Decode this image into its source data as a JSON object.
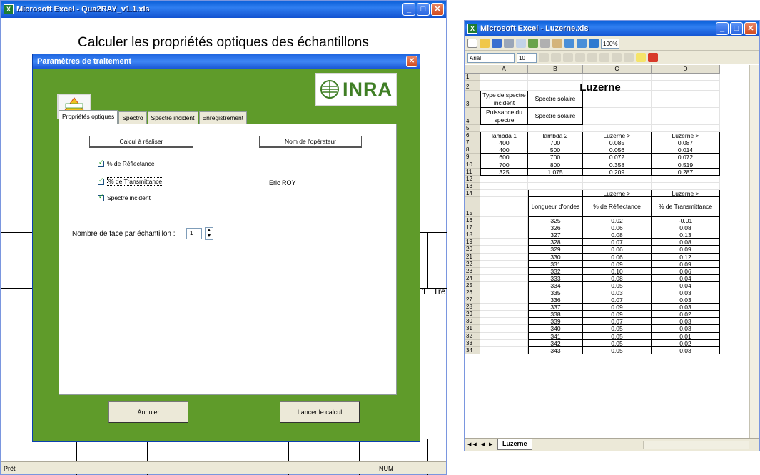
{
  "left_window": {
    "title": "Microsoft Excel - Qua2RAY_v1.1.xls",
    "sheet_title": "Calculer les propriétés optiques des échantillons",
    "background_row_texts": [
      "1",
      "Tre"
    ],
    "status_ready": "Prêt",
    "status_num": "NUM"
  },
  "dialog": {
    "title": "Paramètres de traitement",
    "logo_left_text": "Qua-Ray",
    "logo_right_text": "INRA",
    "tabs": [
      {
        "label": "Propriétés optiques",
        "active": true
      },
      {
        "label": "Spectro",
        "active": false
      },
      {
        "label": "Spectre incident",
        "active": false
      },
      {
        "label": "Enregistrement",
        "active": false
      }
    ],
    "group_calc_label": "Calcul à réaliser",
    "group_operator_label": "Nom de l'opérateur",
    "operator_value": "Eric ROY",
    "checkboxes": [
      {
        "label": "% de Réflectance",
        "checked": true
      },
      {
        "label": "% de Transmittance",
        "checked": true
      },
      {
        "label": "Spectre incident",
        "checked": true
      }
    ],
    "faces_label": "Nombre de face par échantillon :",
    "faces_value": "1",
    "cancel_label": "Annuler",
    "run_label": "Lancer le calcul"
  },
  "right_window": {
    "title": "Microsoft Excel - Luzerne.xls",
    "font_name": "Arial",
    "font_size": "10",
    "zoom": "100%",
    "columns": [
      "A",
      "B",
      "C",
      "D"
    ],
    "sheet_tab": "Luzerne",
    "sheet_heading": "Luzerne",
    "rows": [
      {
        "n": "1",
        "cells": [
          "",
          "",
          "",
          ""
        ]
      },
      {
        "n": "2",
        "cells": [
          "",
          "",
          "",
          ""
        ]
      },
      {
        "n": "3",
        "cells": [
          "Type de spectre incident",
          "Spectre solaire",
          "",
          ""
        ]
      },
      {
        "n": "4",
        "cells": [
          "Puissance du spectre",
          "Spectre solaire",
          "",
          ""
        ]
      },
      {
        "n": "5",
        "cells": [
          "",
          "",
          "",
          ""
        ]
      },
      {
        "n": "6",
        "cells": [
          "lambda 1",
          "lambda 2",
          "Luzerne >",
          "Luzerne >"
        ]
      },
      {
        "n": "7",
        "cells": [
          "400",
          "700",
          "0.085",
          "0.087"
        ]
      },
      {
        "n": "8",
        "cells": [
          "400",
          "500",
          "0.056",
          "0.014"
        ]
      },
      {
        "n": "9",
        "cells": [
          "600",
          "700",
          "0.072",
          "0.072"
        ]
      },
      {
        "n": "10",
        "cells": [
          "700",
          "800",
          "0.358",
          "0.519"
        ]
      },
      {
        "n": "11",
        "cells": [
          "325",
          "1 075",
          "0.209",
          "0.287"
        ]
      },
      {
        "n": "12",
        "cells": [
          "",
          "",
          "",
          ""
        ]
      },
      {
        "n": "13",
        "cells": [
          "",
          "",
          "",
          ""
        ]
      },
      {
        "n": "14",
        "cells": [
          "",
          "",
          "Luzerne >",
          "Luzerne >"
        ]
      },
      {
        "n": "15",
        "cells": [
          "",
          "Longueur d'ondes",
          "% de Réflectance",
          "% de Transmittance"
        ]
      },
      {
        "n": "16",
        "cells": [
          "",
          "325",
          "0.02",
          "-0.01"
        ]
      },
      {
        "n": "17",
        "cells": [
          "",
          "326",
          "0.06",
          "0.08"
        ]
      },
      {
        "n": "18",
        "cells": [
          "",
          "327",
          "0.08",
          "0.13"
        ]
      },
      {
        "n": "19",
        "cells": [
          "",
          "328",
          "0.07",
          "0.08"
        ]
      },
      {
        "n": "20",
        "cells": [
          "",
          "329",
          "0.06",
          "0.09"
        ]
      },
      {
        "n": "21",
        "cells": [
          "",
          "330",
          "0.06",
          "0.12"
        ]
      },
      {
        "n": "22",
        "cells": [
          "",
          "331",
          "0.09",
          "0.09"
        ]
      },
      {
        "n": "23",
        "cells": [
          "",
          "332",
          "0.10",
          "0.06"
        ]
      },
      {
        "n": "24",
        "cells": [
          "",
          "333",
          "0.08",
          "0.04"
        ]
      },
      {
        "n": "25",
        "cells": [
          "",
          "334",
          "0.05",
          "0.04"
        ]
      },
      {
        "n": "26",
        "cells": [
          "",
          "335",
          "0.03",
          "0.03"
        ]
      },
      {
        "n": "27",
        "cells": [
          "",
          "336",
          "0.07",
          "0.03"
        ]
      },
      {
        "n": "28",
        "cells": [
          "",
          "337",
          "0.09",
          "0.03"
        ]
      },
      {
        "n": "29",
        "cells": [
          "",
          "338",
          "0.09",
          "0.02"
        ]
      },
      {
        "n": "30",
        "cells": [
          "",
          "339",
          "0.07",
          "0.03"
        ]
      },
      {
        "n": "31",
        "cells": [
          "",
          "340",
          "0.05",
          "0.03"
        ]
      },
      {
        "n": "32",
        "cells": [
          "",
          "341",
          "0.05",
          "0.01"
        ]
      },
      {
        "n": "33",
        "cells": [
          "",
          "342",
          "0.05",
          "0.02"
        ]
      },
      {
        "n": "34",
        "cells": [
          "",
          "343",
          "0.05",
          "0.03"
        ]
      }
    ]
  },
  "colors": {
    "dialog_green": "#5f9b2a",
    "xp_blue": "#1353d1",
    "inra_green": "#3f7e24"
  }
}
